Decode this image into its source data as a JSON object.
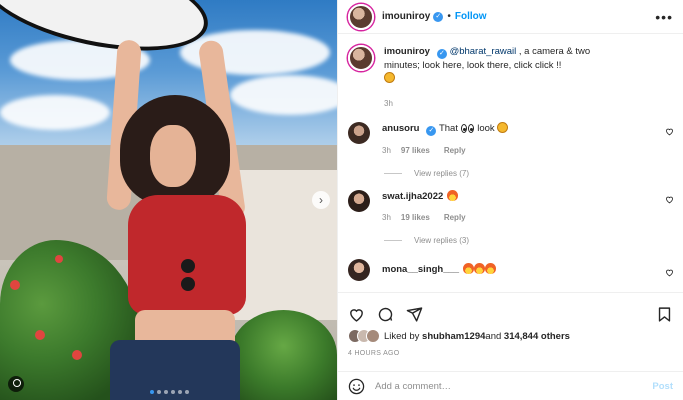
{
  "post": {
    "username": "imouniroy",
    "follow_label": "Follow",
    "separator": "•",
    "more_icon": "more-horizontal-icon"
  },
  "caption": {
    "username": "imouniroy",
    "mention": "@bharat_rawail",
    "text": " , a camera & two minutes; look here, look there, click click !! ",
    "time": "3h"
  },
  "comments": [
    {
      "username": "anusoru",
      "text_before": "That ",
      "text_after": " look ",
      "time": "3h",
      "likes": "97 likes",
      "reply": "Reply",
      "view_replies": "View replies (7)"
    },
    {
      "username": "swat.ijha2022",
      "text": "",
      "time": "3h",
      "likes": "19 likes",
      "reply": "Reply",
      "view_replies": "View replies (3)"
    },
    {
      "username": "mona__singh___",
      "text": ""
    }
  ],
  "likes": {
    "prefix": "Liked by ",
    "user": "shubham1294",
    "middle": " and ",
    "count": "314,844 others"
  },
  "timestamp": "4 HOURS AGO",
  "comment_box": {
    "placeholder": "Add a comment…",
    "post_label": "Post"
  },
  "carousel": {
    "next": "›",
    "total_slides": 6,
    "active_slide": 1
  },
  "colors": {
    "accent": "#0095f6",
    "verified": "#3897f0",
    "muted": "#8e8e8e"
  }
}
